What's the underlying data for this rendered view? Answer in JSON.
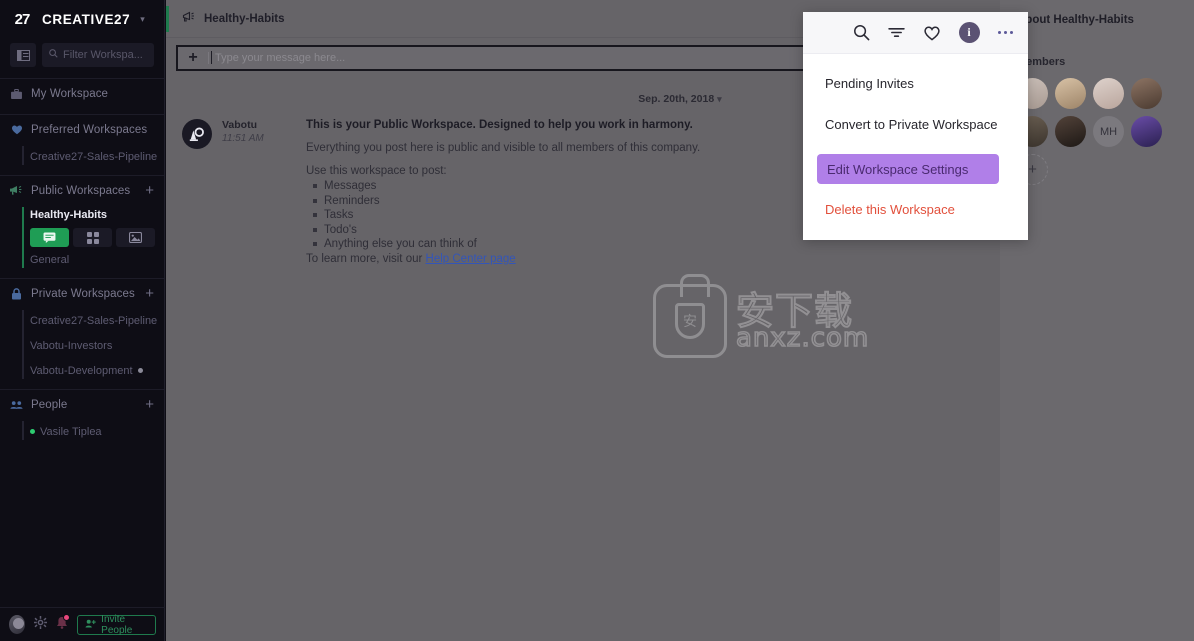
{
  "sidebar": {
    "brand": {
      "logo_text": "27",
      "name": "CREATIVE27",
      "caret": "▾"
    },
    "panel_toggle_icon": "panel-layout-icon",
    "filter": {
      "placeholder": "Filter Workspa...",
      "icon": "search-icon"
    },
    "my_workspace": {
      "label": "My Workspace",
      "icon": "briefcase-icon"
    },
    "preferred": {
      "label": "Preferred Workspaces",
      "icon": "heart-icon",
      "items": [
        "Creative27-Sales-Pipeline"
      ]
    },
    "public": {
      "label": "Public Workspaces",
      "icon": "megaphone-icon",
      "add": "+",
      "workspace_name": "Healthy-Habits",
      "tabs": [
        {
          "name": "chat-tab",
          "icon": "chat-icon",
          "active": true
        },
        {
          "name": "board-tab",
          "icon": "grid-icon",
          "active": false
        },
        {
          "name": "media-tab",
          "icon": "image-icon",
          "active": false
        }
      ],
      "channel": "General"
    },
    "private": {
      "label": "Private Workspaces",
      "icon": "lock-icon",
      "add": "+",
      "items": [
        {
          "label": "Creative27-Sales-Pipeline",
          "dot": false
        },
        {
          "label": "Vabotu-Investors",
          "dot": false
        },
        {
          "label": "Vabotu-Development",
          "dot": true
        }
      ]
    },
    "people": {
      "label": "People",
      "icon": "people-icon",
      "add": "+",
      "items": [
        {
          "label": "Vasile Tiplea",
          "online": true
        }
      ]
    },
    "bottom": {
      "avatar": "user-avatar",
      "settings_icon": "gear-icon",
      "notifications_icon": "bell-icon",
      "invite_label": "Invite People",
      "invite_icon": "add-person-icon"
    }
  },
  "main": {
    "header": {
      "title": "Healthy-Habits",
      "icon": "megaphone-icon"
    },
    "composer": {
      "placeholder": "Type your message here...",
      "add_icon": "plus-icon"
    },
    "date_separator": "Sep. 20th, 2018",
    "date_caret": "▾",
    "message": {
      "author": "Vabotu",
      "time": "11:51 AM",
      "avatar_icon": "vabotu-logo-icon",
      "lead": "This is your Public Workspace. Designed to help you work in harmony.",
      "paragraph": "Everything you post here is public and visible to all members of this company.",
      "list_intro": "Use this workspace to post:",
      "list": [
        "Messages",
        "Reminders",
        "Tasks",
        "Todo's",
        "Anything else you can think of"
      ],
      "footer_prefix": "To learn more, visit our ",
      "footer_link": "Help Center page"
    }
  },
  "right_panel": {
    "title": "About Healthy-Habits",
    "members_label": "Members",
    "members": [
      {
        "name": "member-1",
        "type": "photo"
      },
      {
        "name": "member-2",
        "type": "photo"
      },
      {
        "name": "member-3",
        "type": "photo"
      },
      {
        "name": "member-4",
        "type": "photo"
      },
      {
        "name": "member-5",
        "type": "photo"
      },
      {
        "name": "member-6",
        "type": "photo"
      },
      {
        "name": "member-7",
        "type": "initials",
        "initials": "MH"
      },
      {
        "name": "member-8",
        "type": "photo"
      }
    ],
    "add_member": "+"
  },
  "menu": {
    "icons": [
      {
        "name": "search-icon",
        "label": "Search"
      },
      {
        "name": "filter-icon",
        "label": "Filter"
      },
      {
        "name": "heart-icon",
        "label": "Favorite"
      },
      {
        "name": "info-icon",
        "label": "i"
      },
      {
        "name": "more-options-icon",
        "label": "More"
      }
    ],
    "items": [
      {
        "name": "pending-invites",
        "label": "Pending Invites",
        "style": "normal"
      },
      {
        "name": "convert-to-private-workspace",
        "label": "Convert to Private Workspace",
        "style": "normal"
      },
      {
        "name": "edit-workspace-settings",
        "label": "Edit Workspace Settings",
        "style": "highlight"
      },
      {
        "name": "delete-this-workspace",
        "label": "Delete this Workspace",
        "style": "danger"
      }
    ]
  },
  "watermark": {
    "cn": "安下载",
    "en": "anxz.com",
    "badge": "安"
  },
  "colors": {
    "sidebar_bg": "#0e0d15",
    "accent_green": "#1f9d55",
    "highlight_purple": "#b07fe8",
    "danger_red": "#e2503c",
    "info_purple": "#5b5273",
    "overlay_gray": "#666468"
  }
}
